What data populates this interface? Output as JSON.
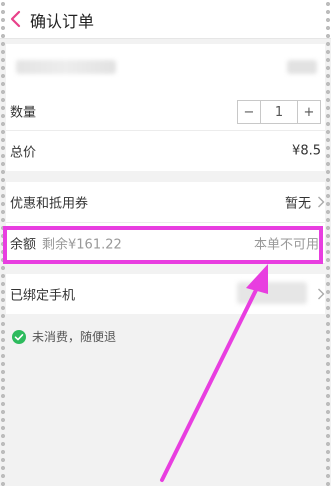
{
  "header": {
    "title": "确认订单"
  },
  "quantity": {
    "label": "数量",
    "minus": "−",
    "value": "1",
    "plus": "+"
  },
  "total": {
    "label": "总价",
    "value": "¥8.5"
  },
  "coupon": {
    "label": "优惠和抵用券",
    "value": "暂无"
  },
  "balance": {
    "label": "余额",
    "remaining": "剩余¥161.22",
    "status": "本单不可用"
  },
  "phone": {
    "label": "已绑定手机"
  },
  "note": {
    "text": "未消费，随便退"
  },
  "colors": {
    "highlight": "#e83ee0",
    "check": "#2dbb5d",
    "back": "#e8418a"
  }
}
